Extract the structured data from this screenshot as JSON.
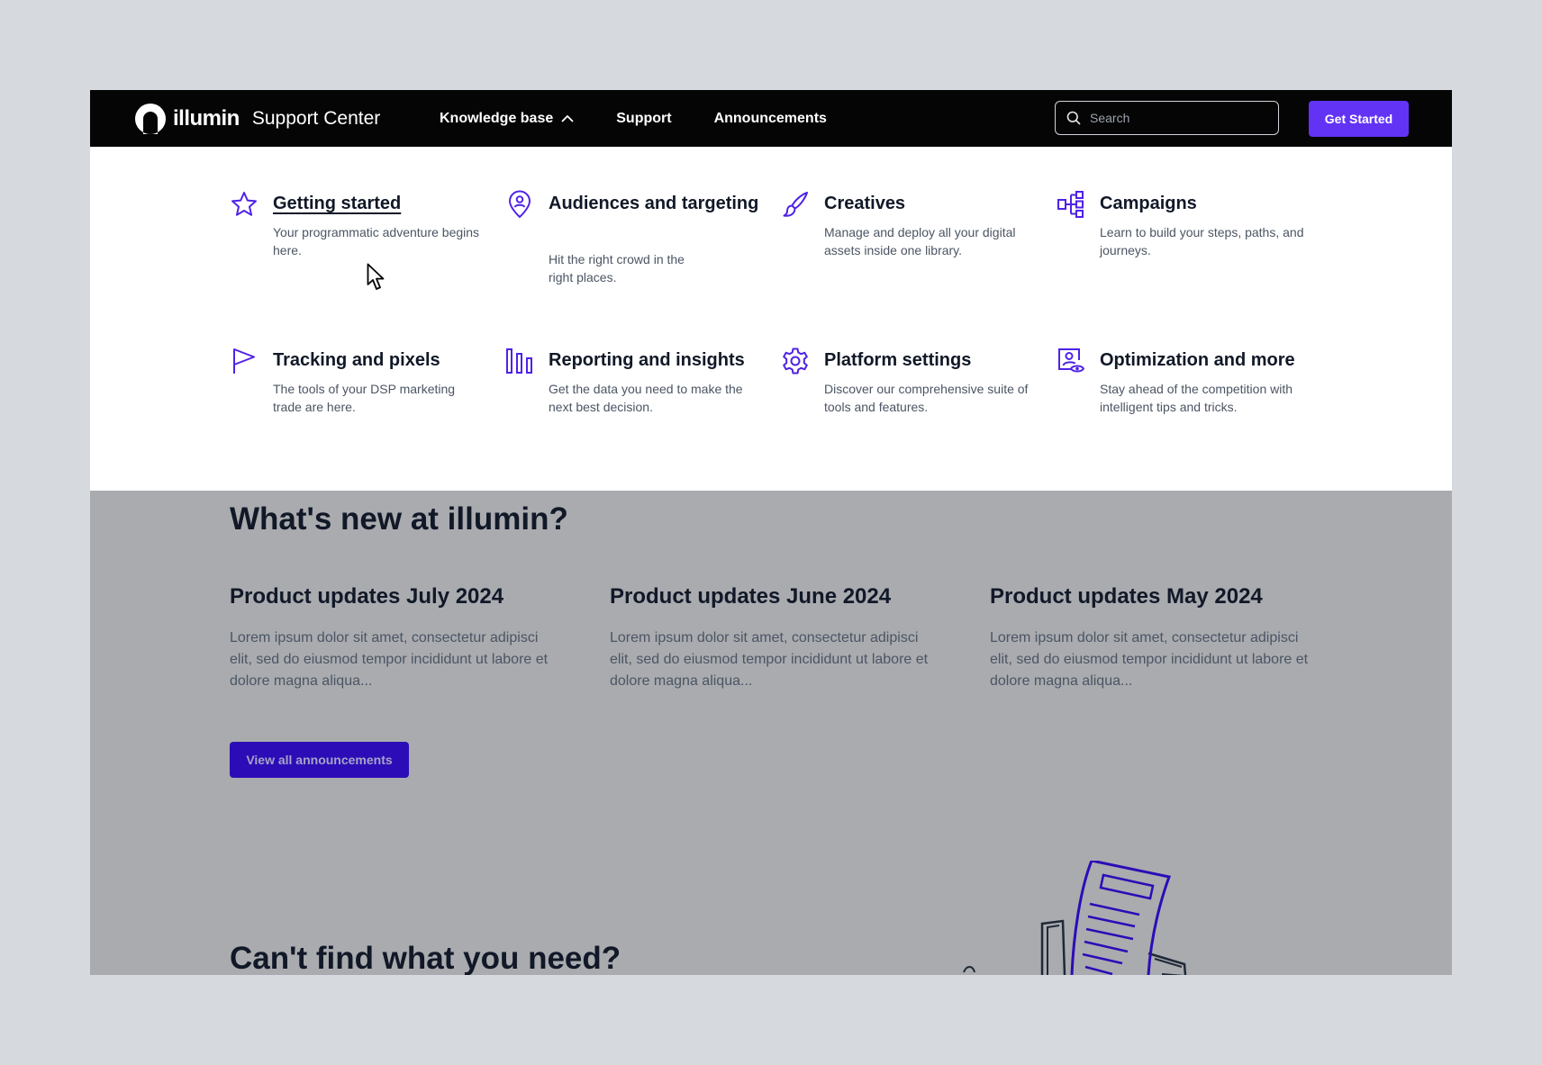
{
  "header": {
    "brand": "illumin",
    "brand_subtitle": "Support Center",
    "nav": [
      {
        "label": "Knowledge base"
      },
      {
        "label": "Support"
      },
      {
        "label": "Announcements"
      }
    ],
    "search_placeholder": "Search",
    "cta_label": "Get Started"
  },
  "knowledge_base": {
    "categories": [
      {
        "title": "Getting started",
        "desc": "Your programmatic adventure begins here.",
        "icon": "star-icon"
      },
      {
        "title": "Audiences and targeting",
        "desc": "Hit the right crowd in the right places.",
        "icon": "location-person-icon"
      },
      {
        "title": "Creatives",
        "desc": "Manage and deploy all your digital assets inside one library.",
        "icon": "brush-icon"
      },
      {
        "title": "Campaigns",
        "desc": "Learn to build your steps, paths, and journeys.",
        "icon": "flow-icon"
      },
      {
        "title": "Tracking and pixels",
        "desc": "The tools of your DSP marketing trade are here.",
        "icon": "flag-icon"
      },
      {
        "title": "Reporting and insights",
        "desc": "Get the data you need to make the next best decision.",
        "icon": "bar-chart-icon"
      },
      {
        "title": "Platform settings",
        "desc": "Discover our comprehensive suite of tools and features.",
        "icon": "gear-icon"
      },
      {
        "title": "Optimization and more",
        "desc": "Stay ahead of the competition with intelligent tips and tricks.",
        "icon": "profile-eye-icon"
      }
    ]
  },
  "whats_new": {
    "title": "What's new at illumin?",
    "cards": [
      {
        "title": "Product updates July 2024",
        "body": "Lorem ipsum dolor sit amet, consectetur adipisci elit, sed do eiusmod tempor incididunt ut labore et dolore magna aliqua..."
      },
      {
        "title": "Product updates June 2024",
        "body": "Lorem ipsum dolor sit amet, consectetur adipisci elit, sed do eiusmod tempor incididunt ut labore et dolore magna aliqua..."
      },
      {
        "title": "Product updates May 2024",
        "body": "Lorem ipsum dolor sit amet, consectetur adipisci elit, sed do eiusmod tempor incididunt ut labore et dolore magna aliqua..."
      }
    ],
    "button_label": "View all announcements"
  },
  "help": {
    "title": "Can't find what you need?"
  },
  "colors": {
    "accent": "#6233f5",
    "icon": "#4f22e6",
    "header_bg": "#050505",
    "overlay_bg": "#a9abaf"
  }
}
